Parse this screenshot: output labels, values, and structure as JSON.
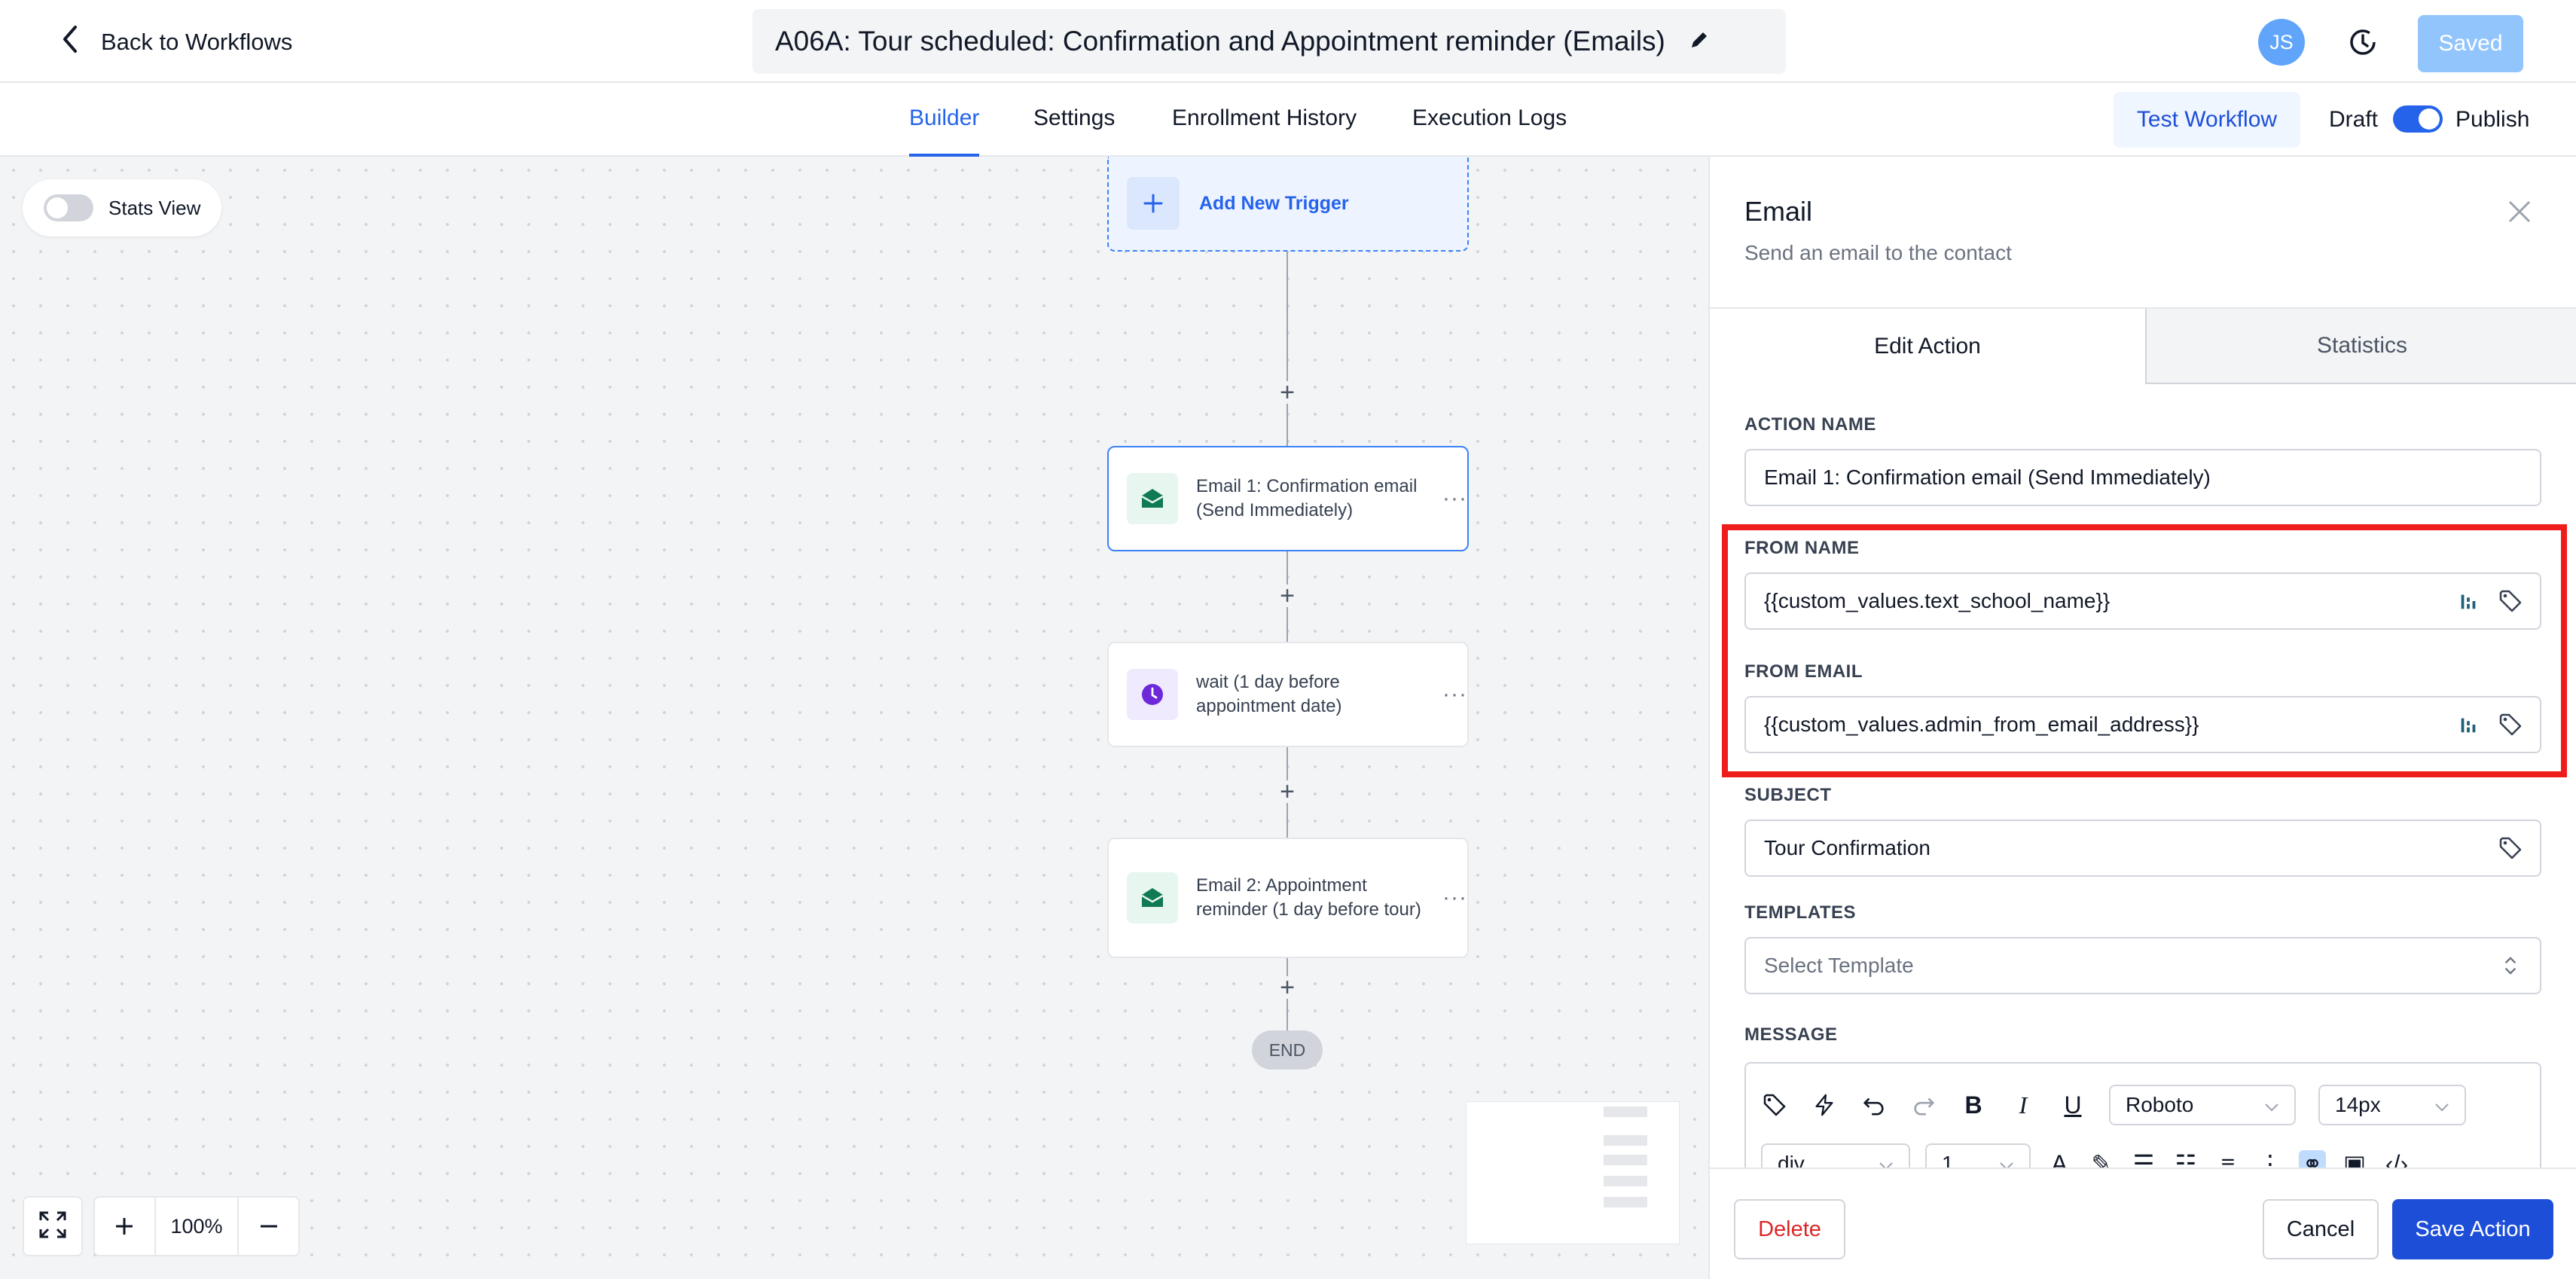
{
  "header": {
    "back_label": "Back to Workflows",
    "title": "A06A: Tour scheduled: Confirmation and Appointment reminder (Emails)",
    "avatar_initials": "JS",
    "saved_label": "Saved"
  },
  "nav": {
    "tabs": [
      {
        "label": "Builder",
        "active": true
      },
      {
        "label": "Settings"
      },
      {
        "label": "Enrollment History"
      },
      {
        "label": "Execution Logs"
      }
    ],
    "test_workflow_label": "Test Workflow",
    "draft_label": "Draft",
    "publish_label": "Publish",
    "publish_enabled": true
  },
  "canvas": {
    "stats_view_label": "Stats View",
    "stats_view_enabled": false,
    "trigger_label": "Add New Trigger",
    "nodes": [
      {
        "label": "Email 1: Confirmation email (Send Immediately)",
        "icon": "envelope-open-icon",
        "selected": true
      },
      {
        "label": "wait (1 day before appointment date)",
        "icon": "clock-icon"
      },
      {
        "label": "Email 2: Appointment reminder (1 day before tour)",
        "icon": "envelope-open-icon"
      }
    ],
    "end_label": "END",
    "zoom_value": "100%"
  },
  "panel": {
    "title": "Email",
    "subtitle": "Send an email to the contact",
    "tabs": [
      {
        "label": "Edit Action",
        "active": true
      },
      {
        "label": "Statistics"
      }
    ],
    "action_name": {
      "label": "ACTION NAME",
      "value": "Email 1: Confirmation email (Send Immediately)"
    },
    "from_name": {
      "label": "FROM NAME",
      "value": "{{custom_values.text_school_name}}"
    },
    "from_email": {
      "label": "FROM EMAIL",
      "value": "{{custom_values.admin_from_email_address}}"
    },
    "subject": {
      "label": "SUBJECT",
      "value": "Tour Confirmation"
    },
    "templates": {
      "label": "TEMPLATES",
      "placeholder": "Select Template"
    },
    "message": {
      "label": "MESSAGE",
      "font_family": "Roboto",
      "font_size": "14px",
      "block_format": "div",
      "line_height": "1"
    },
    "buttons": {
      "delete": "Delete",
      "cancel": "Cancel",
      "save": "Save Action"
    }
  },
  "colors": {
    "accent": "#2563eb",
    "highlight": "#ef1c1c",
    "email_icon": "#0f7a55",
    "wait_icon": "#6d28d9",
    "delete": "#dc2626"
  }
}
